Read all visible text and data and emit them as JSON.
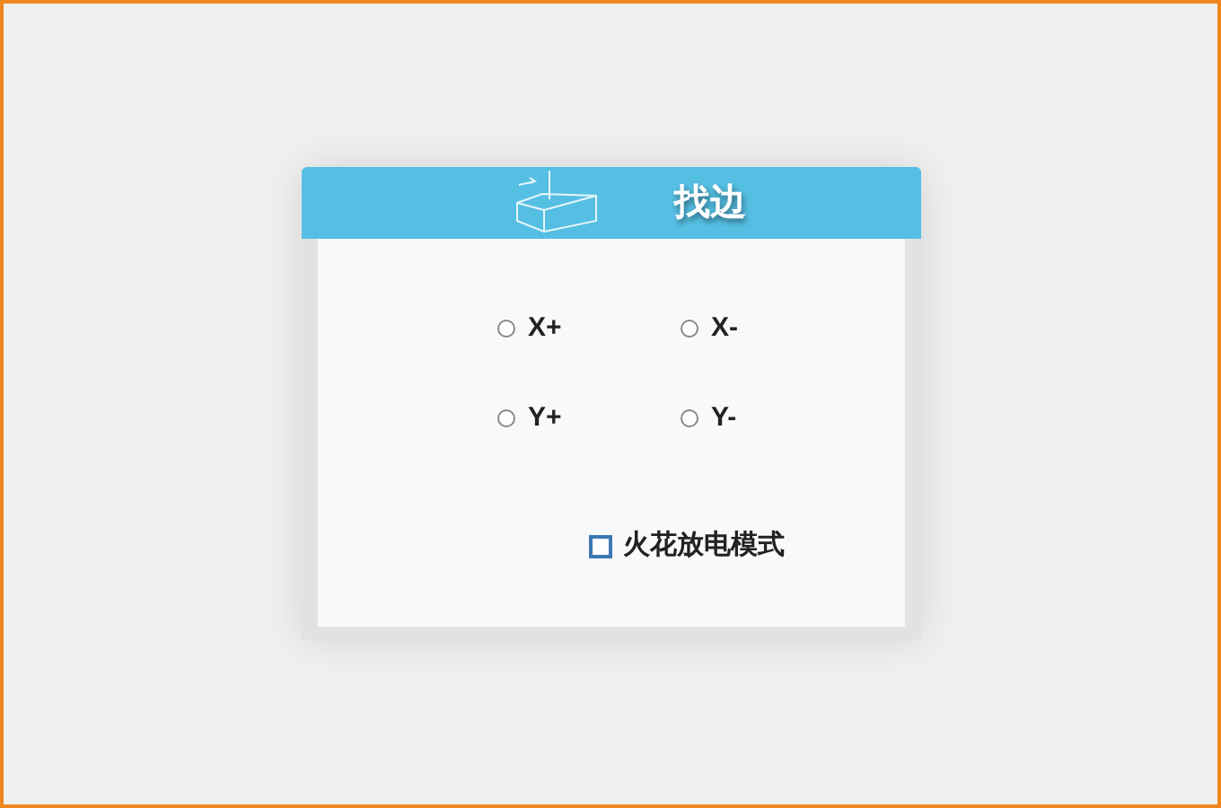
{
  "dialog": {
    "title": "找边"
  },
  "directions": [
    {
      "label": "X+",
      "selected": false
    },
    {
      "label": "X-",
      "selected": false
    },
    {
      "label": "Y+",
      "selected": false
    },
    {
      "label": "Y-",
      "selected": false
    }
  ],
  "spark_mode": {
    "label": "火花放电模式",
    "checked": false
  }
}
